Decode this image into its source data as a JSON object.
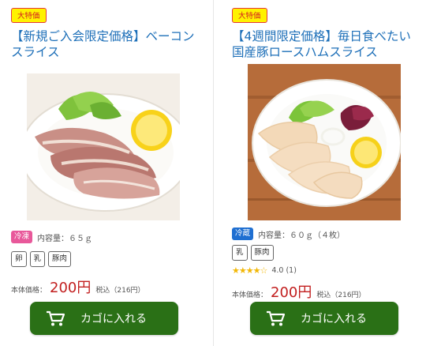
{
  "products": [
    {
      "badge": "大特価",
      "title_line1": "【新規ご入会限定価格】ベーコン",
      "title_line2": "スライス",
      "storage": "冷凍",
      "content_label": "内容量：６５ｇ",
      "allergens": [
        "卵",
        "乳",
        "豚肉"
      ],
      "price_label": "本体価格：",
      "price": "200円",
      "tax_note": "税込（216円）",
      "cart_label": "カゴに入れる"
    },
    {
      "badge": "大特価",
      "title_line1": "【4週間限定価格】毎日食べたい",
      "title_line2": "国産豚ロースハムスライス",
      "storage": "冷蔵",
      "content_label": "内容量：６０ｇ（４枚）",
      "allergens": [
        "乳",
        "豚肉"
      ],
      "rating_stars": "★★★★☆",
      "rating_value": 4.0,
      "rating_text": "4.0 (1)",
      "price_label": "本体価格：",
      "price": "200円",
      "tax_note": "税込（216円）",
      "cart_label": "カゴに入れる"
    }
  ],
  "colors": {
    "badge_bg": "#fff200",
    "badge_text": "#d42020",
    "title": "#1d6fb8",
    "price": "#c21f1f",
    "cart_button": "#2a7016",
    "frozen_tag": "#e8589a",
    "chilled_tag": "#1f6fd1"
  },
  "icons": {
    "cart": "shopping-cart-icon",
    "star": "star-icon"
  }
}
